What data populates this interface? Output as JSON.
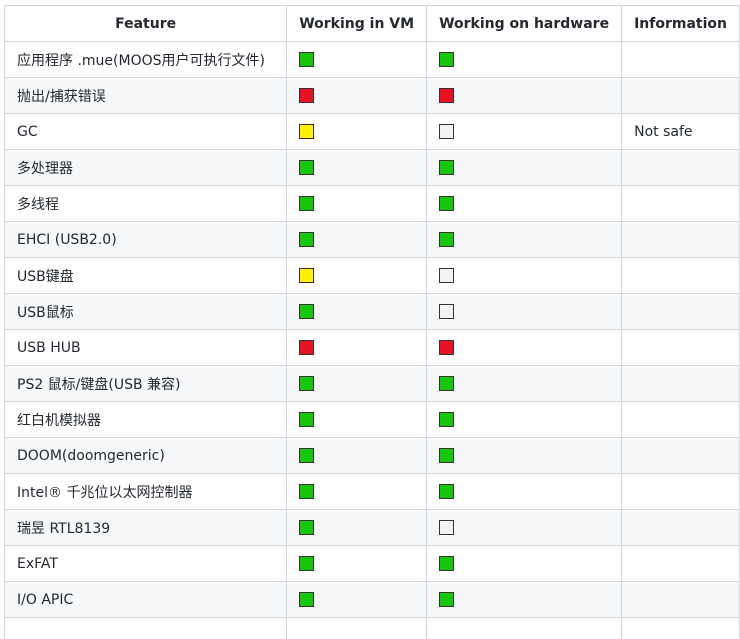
{
  "table": {
    "headers": {
      "feature": "Feature",
      "vm": "Working in VM",
      "hw": "Working on hardware",
      "info": "Information"
    },
    "status_colors": {
      "green": "#16c60c",
      "red": "#e81224",
      "yellow": "#fff100",
      "white": "#f3f3f3"
    },
    "rows": [
      {
        "feature": "应用程序 .mue(MOOS用户可执行文件)",
        "vm": "green",
        "hw": "green",
        "info": ""
      },
      {
        "feature": "抛出/捕获错误",
        "vm": "red",
        "hw": "red",
        "info": ""
      },
      {
        "feature": "GC",
        "vm": "yellow",
        "hw": "white",
        "info": "Not safe"
      },
      {
        "feature": "多处理器",
        "vm": "green",
        "hw": "green",
        "info": ""
      },
      {
        "feature": "多线程",
        "vm": "green",
        "hw": "green",
        "info": ""
      },
      {
        "feature": "EHCI (USB2.0)",
        "vm": "green",
        "hw": "green",
        "info": ""
      },
      {
        "feature": "USB键盘",
        "vm": "yellow",
        "hw": "white",
        "info": ""
      },
      {
        "feature": "USB鼠标",
        "vm": "green",
        "hw": "white",
        "info": ""
      },
      {
        "feature": "USB HUB",
        "vm": "red",
        "hw": "red",
        "info": ""
      },
      {
        "feature": "PS2 鼠标/键盘(USB 兼容)",
        "vm": "green",
        "hw": "green",
        "info": ""
      },
      {
        "feature": "红白机模拟器",
        "vm": "green",
        "hw": "green",
        "info": ""
      },
      {
        "feature": "DOOM(doomgeneric)",
        "vm": "green",
        "hw": "green",
        "info": ""
      },
      {
        "feature": "Intel® 千兆位以太网控制器",
        "vm": "green",
        "hw": "green",
        "info": ""
      },
      {
        "feature": "瑞昱 RTL8139",
        "vm": "green",
        "hw": "white",
        "info": ""
      },
      {
        "feature": "ExFAT",
        "vm": "green",
        "hw": "green",
        "info": ""
      },
      {
        "feature": "I/O APIC",
        "vm": "green",
        "hw": "green",
        "info": ""
      },
      {
        "feature": "",
        "vm": "",
        "hw": "",
        "info": ""
      }
    ]
  }
}
